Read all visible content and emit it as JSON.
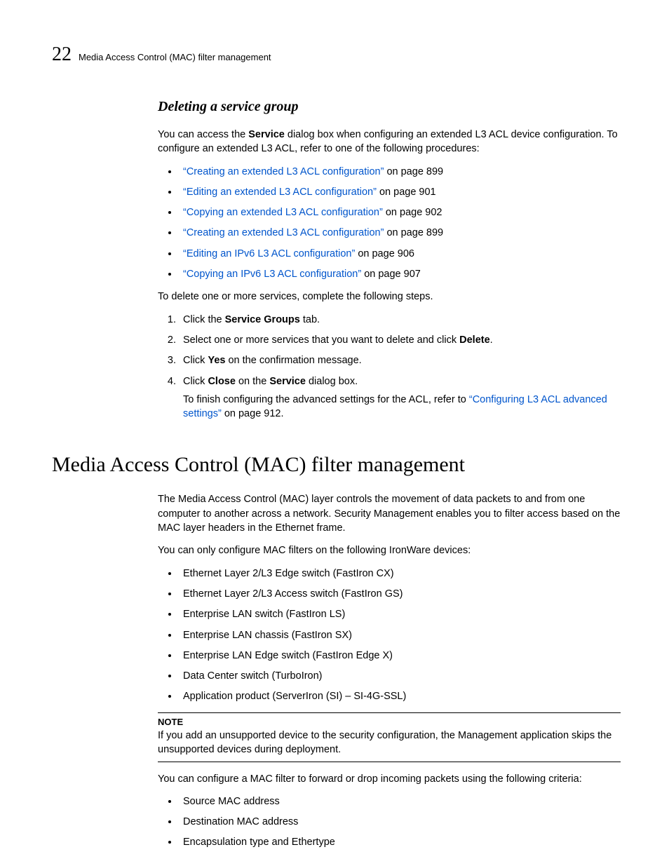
{
  "header": {
    "chapter_number": "22",
    "title": "Media Access Control (MAC) filter management"
  },
  "section1": {
    "heading": "Deleting a service group",
    "intro_pre": "You can access the ",
    "intro_bold": "Service",
    "intro_post": " dialog box when configuring an extended L3 ACL device configuration. To configure an extended L3 ACL, refer to one of the following procedures:",
    "links": [
      {
        "text": "“Creating an extended L3 ACL configuration”",
        "page": " on page 899"
      },
      {
        "text": "“Editing an extended L3 ACL configuration”",
        "page": " on page 901"
      },
      {
        "text": "“Copying an extended L3 ACL configuration”",
        "page": " on page 902"
      },
      {
        "text": "“Creating an extended L3 ACL configuration”",
        "page": " on page 899"
      },
      {
        "text": "“Editing an IPv6 L3 ACL configuration”",
        "page": " on page 906"
      },
      {
        "text": "“Copying an IPv6 L3 ACL configuration”",
        "page": " on page 907"
      }
    ],
    "steps_intro": "To delete one or more services, complete the following steps.",
    "step1_pre": "Click the ",
    "step1_bold": "Service Groups",
    "step1_post": " tab.",
    "step2_pre": "Select one or more services that you want to delete and click ",
    "step2_bold": "Delete",
    "step2_post": ".",
    "step3_pre": "Click ",
    "step3_bold": "Yes",
    "step3_post": " on the confirmation message.",
    "step4_pre": "Click ",
    "step4_bold1": "Close",
    "step4_mid": " on the ",
    "step4_bold2": "Service",
    "step4_post": " dialog box.",
    "step4_sub_pre": "To finish configuring the advanced settings for the ACL, refer to ",
    "step4_sub_link": "“Configuring L3 ACL advanced settings”",
    "step4_sub_post": " on page 912."
  },
  "section2": {
    "heading": "Media Access Control (MAC) filter management",
    "para1": "The Media Access Control (MAC) layer controls the movement of data packets to and from one computer to another across a network. Security Management enables you to filter access based on the MAC layer headers in the Ethernet frame.",
    "para2": "You can only configure MAC filters on the following IronWare devices:",
    "devices": [
      "Ethernet Layer 2/L3 Edge switch (FastIron CX)",
      "Ethernet Layer 2/L3 Access switch (FastIron GS)",
      "Enterprise LAN switch (FastIron LS)",
      "Enterprise LAN chassis (FastIron SX)",
      "Enterprise LAN Edge switch (FastIron Edge X)",
      "Data Center switch (TurboIron)",
      "Application product (ServerIron (SI) – SI-4G-SSL)"
    ],
    "note_label": "NOTE",
    "note_body": "If you add an unsupported device to the security configuration, the Management application skips the unsupported devices during deployment.",
    "para3": "You can configure a MAC filter to forward or drop incoming packets using the following criteria:",
    "criteria": [
      "Source MAC address",
      "Destination MAC address",
      "Encapsulation type and Ethertype"
    ]
  }
}
